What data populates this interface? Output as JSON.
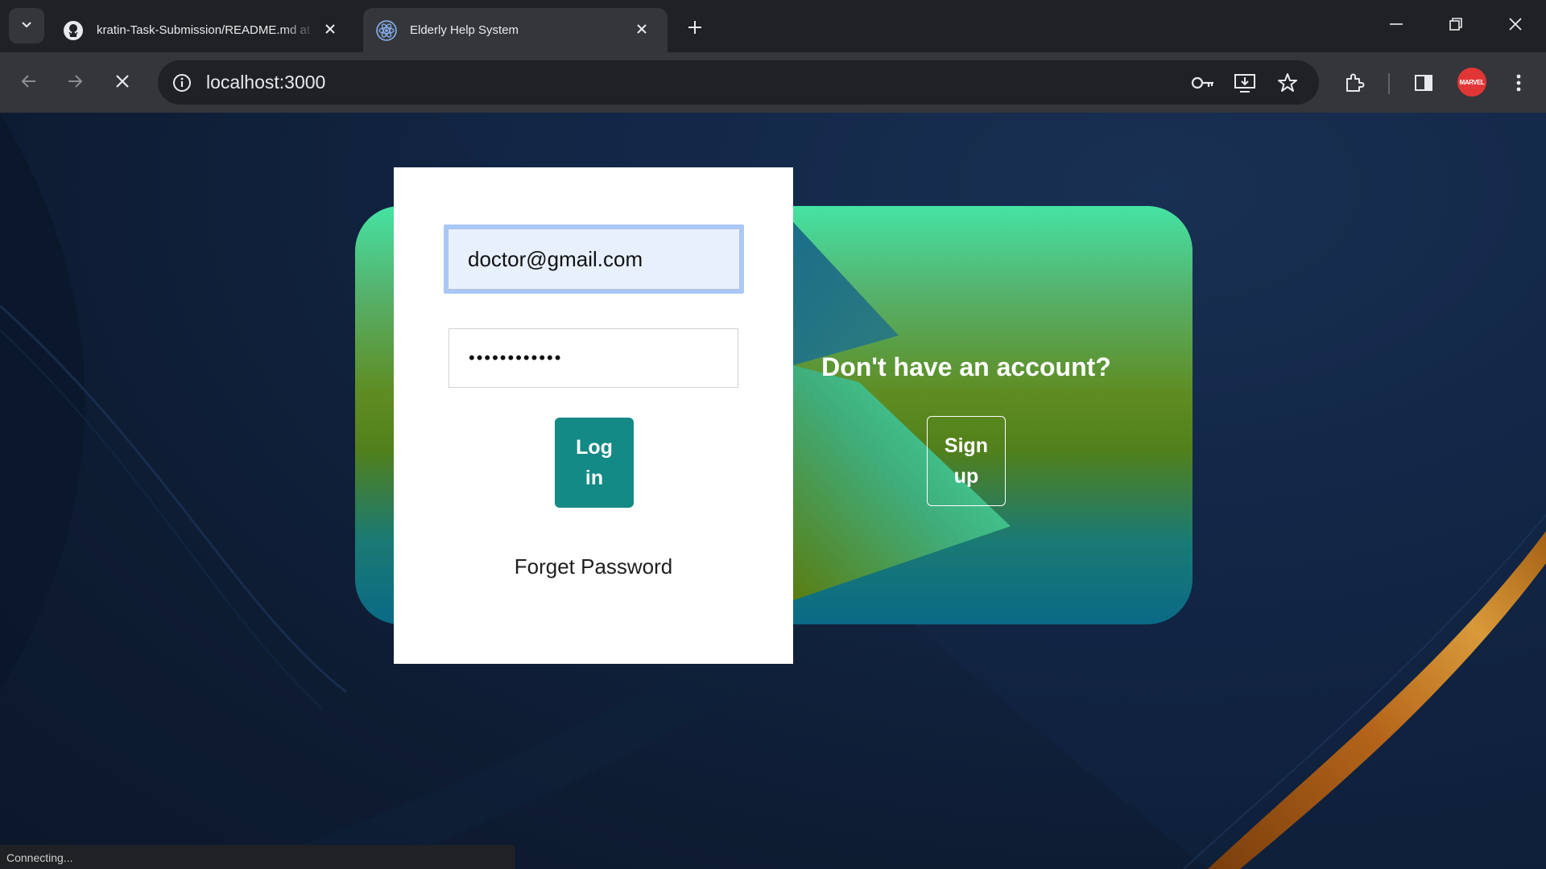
{
  "browser": {
    "tabs": [
      {
        "title": "kratin-Task-Submission/README.md at m",
        "icon": "github-icon",
        "active": false
      },
      {
        "title": "Elderly Help System",
        "icon": "react-icon",
        "active": true
      }
    ],
    "url": "localhost:3000",
    "profile_avatar": "MARVEL",
    "status_text": "Connecting..."
  },
  "login": {
    "email_value": "doctor@gmail.com",
    "password_value": "••••••••••••",
    "login_button": "Log in",
    "forget_password": "Forget Password"
  },
  "signup": {
    "heading": "Don't have an account?",
    "button": "Sign up"
  },
  "colors": {
    "login_button": "#138a85",
    "card_top": "#45e3a3",
    "card_mid": "#5f8c22",
    "card_bottom": "#0a6a86",
    "page_background": "#0e1c33"
  }
}
